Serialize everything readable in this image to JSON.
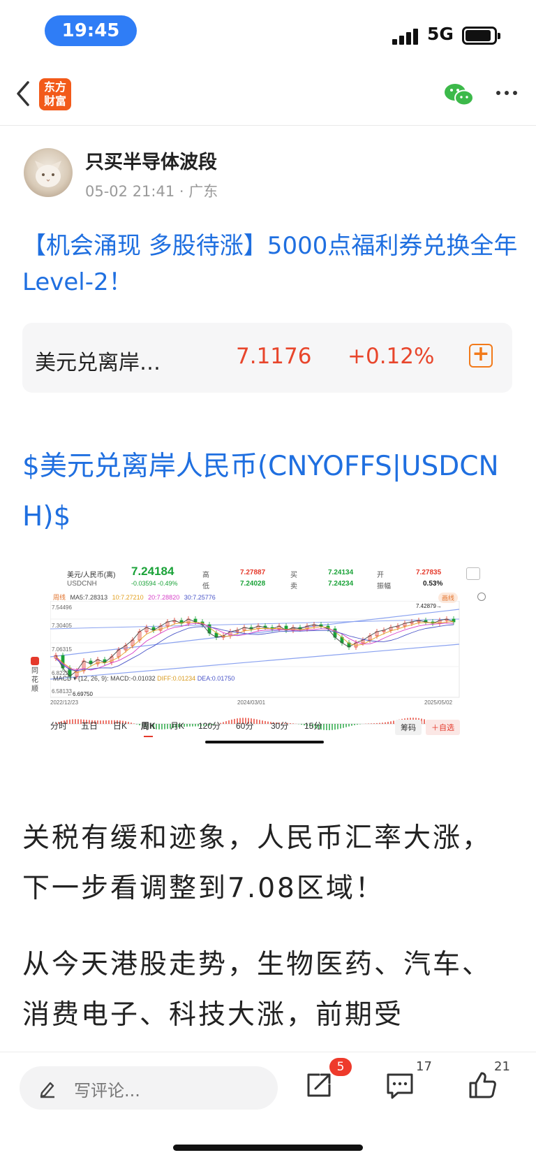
{
  "status_bar": {
    "time": "19:45",
    "network": "5G"
  },
  "nav": {
    "app_name": "东方财富",
    "app_line1": "东方",
    "app_line2": "财富"
  },
  "post": {
    "author": "只买半导体波段",
    "meta": "05-02 21:41 · 广东",
    "promo_link": "【机会涌现 多股待涨】5000点福利券兑换全年Level-2！",
    "quote": {
      "name": "美元兑离岸…",
      "price": "7.1176",
      "change": "+0.12%"
    },
    "stock_tag": "$美元兑离岸人民币(CNYOFFS|USDCNH)$",
    "paragraphs": [
      "关税有缓和迹象，人民币汇率大涨，下一步看调整到7.08区域！",
      "从今天港股走势，生物医药、汽车、消费电子、科技大涨，前期受"
    ]
  },
  "chart_image": {
    "name_cn": "美元/人民币(离)",
    "code": "USDCNH",
    "price": "7.24184",
    "change": "-0.03594  -0.49%",
    "high_label": "高",
    "high": "7.27887",
    "low_label": "低",
    "low": "7.24028",
    "buy_label": "买",
    "buy": "7.24134",
    "sell_label": "卖",
    "sell": "7.24234",
    "open_label": "开",
    "open": "7.27835",
    "amp_label": "振幅",
    "amp": "0.53%",
    "ma_line": [
      "周线",
      "MA5:7.28313",
      "10:7.27210",
      "20:7.28820",
      "30:7.25776"
    ],
    "draw_btn": "画线",
    "y_ticks": [
      "7.54496",
      "7.30405",
      "7.06315",
      "6.82224",
      "6.58133"
    ],
    "high_mark": "7.42879",
    "low_mark": "6.69750",
    "x_ticks": [
      "2022/12/23",
      "2024/03/01",
      "2025/05/02"
    ],
    "macd_header": [
      "MACD ▾",
      "(12, 26, 9):",
      "MACD:-0.01032",
      "DIFF:0.01234",
      "DEA:0.01750"
    ],
    "side_tag": "同花顺",
    "tabs": [
      "分时",
      "五日",
      "日K",
      "周K",
      "月K",
      "120分",
      "60分",
      "30分",
      "15分"
    ],
    "active_tab": "周K",
    "chip_chip": "筹码",
    "chip_watch": "＋自选"
  },
  "bottom_bar": {
    "comment_placeholder": "写评论...",
    "share_badge": "5",
    "comment_count": "17",
    "like_count": "21"
  },
  "colors": {
    "link_blue": "#1f6fe0",
    "up_red": "#e8462c",
    "down_green": "#1aa238",
    "brand_orange": "#f25a1a"
  }
}
